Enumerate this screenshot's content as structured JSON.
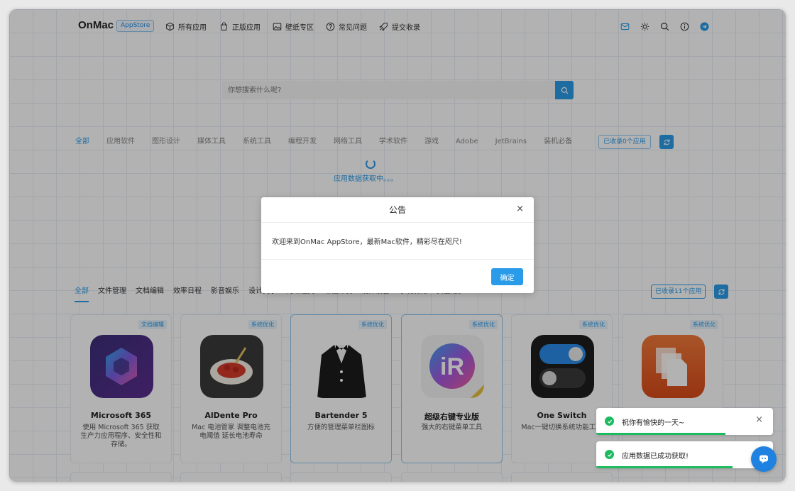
{
  "nav": {
    "logo": "OnMac",
    "badge": "AppStore",
    "items": [
      {
        "label": "所有应用",
        "icon": "cube-icon"
      },
      {
        "label": "正版应用",
        "icon": "bag-icon"
      },
      {
        "label": "壁纸专区",
        "icon": "image-icon"
      },
      {
        "label": "常见问题",
        "icon": "question-icon"
      },
      {
        "label": "提交收录",
        "icon": "rocket-icon"
      }
    ],
    "right_icons": [
      "mail-icon",
      "sun-icon",
      "search-icon",
      "info-icon",
      "telegram-icon"
    ]
  },
  "search": {
    "placeholder": "你想搜索什么呢?"
  },
  "categories_top": {
    "items": [
      "全部",
      "应用软件",
      "图形设计",
      "媒体工具",
      "系统工具",
      "编程开发",
      "网络工具",
      "学术软件",
      "游戏",
      "Adobe",
      "JetBrains",
      "装机必备"
    ],
    "active": 0,
    "count_label": "已收录0个应用"
  },
  "loading_text": "应用数据获取中。。。",
  "categories_bottom": {
    "items": [
      "全部",
      "文件管理",
      "文档编辑",
      "效率日程",
      "影音娱乐",
      "设计美学",
      "网络社交",
      "编程开发",
      "硬件设备",
      "系统优化",
      "安全防护"
    ],
    "active": 0,
    "count_label": "已收录11个应用"
  },
  "apps": [
    {
      "name": "Microsoft 365",
      "tag": "文档编辑",
      "desc": "使用 Microsoft 365 获取生产力应用程序、安全性和存储。",
      "icon": "microsoft-365-icon"
    },
    {
      "name": "AlDente Pro",
      "tag": "系统优化",
      "desc": "Mac 电池管家 调整电池充电阈值 延长电池寿命",
      "icon": "aldente-icon"
    },
    {
      "name": "Bartender 5",
      "tag": "系统优化",
      "desc": "方便的管理菜单栏图标",
      "icon": "bartender-icon"
    },
    {
      "name": "超级右键专业版",
      "tag": "系统优化",
      "desc": "强大的右键菜单工具",
      "icon": "irightmouse-icon"
    },
    {
      "name": "One Switch",
      "tag": "系统优化",
      "desc": "Mac一键切换系统功能工具",
      "icon": "one-switch-icon"
    },
    {
      "name": "",
      "tag": "系统优化",
      "desc": "",
      "icon": "files-icon"
    }
  ],
  "modal": {
    "title": "公告",
    "body": "欢迎来到OnMac AppStore，最新Mac软件，精彩尽在咫尺!",
    "ok_label": "确定",
    "close": "×"
  },
  "toasts": [
    {
      "message": "祝你有愉快的一天~",
      "progress": 0.73
    },
    {
      "message": "应用数据已成功获取!",
      "progress": 0.77
    }
  ],
  "colors": {
    "accent": "#2a9be8",
    "success": "#1dbb5f",
    "overlay": "rgba(0,0,0,0.30)"
  }
}
